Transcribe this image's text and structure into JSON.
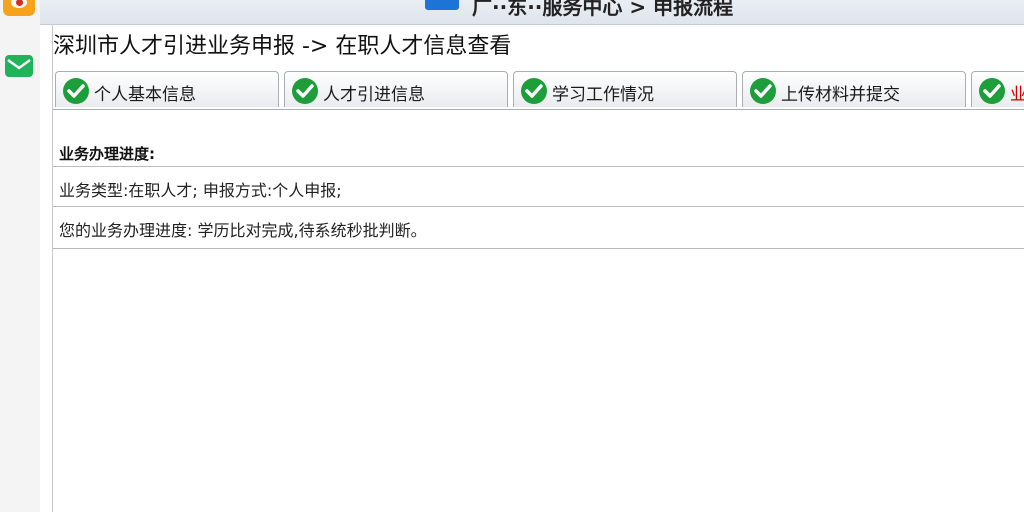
{
  "header": {
    "partial_title": "广··东··服务中心 > 申报流程"
  },
  "page": {
    "title": "深圳市人才引进业务申报 -> 在职人才信息查看"
  },
  "tabs": [
    {
      "label": "个人基本信息",
      "completed": true
    },
    {
      "label": "人才引进信息",
      "completed": true
    },
    {
      "label": "学习工作情况",
      "completed": true
    },
    {
      "label": "上传材料并提交",
      "completed": true
    },
    {
      "label": "业",
      "completed": true,
      "color": "#cc0000"
    }
  ],
  "progress": {
    "heading": "业务办理进度:",
    "business_info": "业务类型:在职人才; 申报方式:个人申报;",
    "status": "您的业务办理进度: 学历比对完成,待系统秒批判断。"
  },
  "colors": {
    "check_green": "#1e9e3a",
    "weibo_orange": "#f7a21b",
    "mail_green": "#1fb35a",
    "active_tab_text": "#cc0000"
  }
}
